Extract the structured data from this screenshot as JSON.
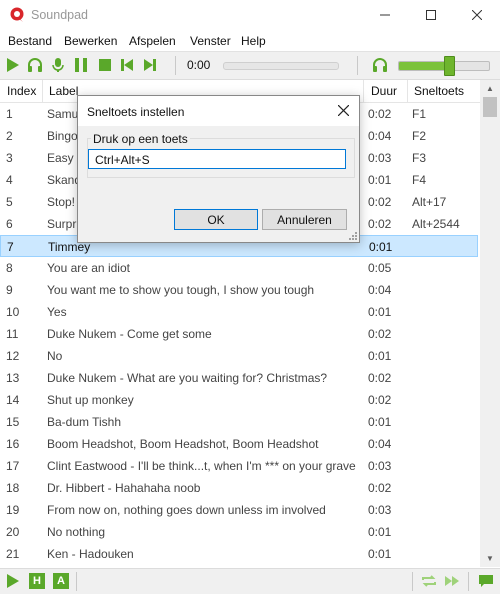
{
  "app": {
    "title": "Soundpad"
  },
  "menu": [
    "Bestand",
    "Bewerken",
    "Afspelen",
    "Venster",
    "Help"
  ],
  "player": {
    "time": "0:00",
    "progress": 0,
    "volume": 0.55
  },
  "table": {
    "columns": {
      "index": "Index",
      "label": "Label",
      "duration": "Duur",
      "hotkey": "Sneltoets"
    },
    "rows": [
      {
        "index": "1",
        "label": "Samu",
        "duration": "0:02",
        "hotkey": "F1"
      },
      {
        "index": "2",
        "label": "Bingo",
        "duration": "0:04",
        "hotkey": "F2"
      },
      {
        "index": "3",
        "label": "Easy p",
        "duration": "0:03",
        "hotkey": "F3"
      },
      {
        "index": "4",
        "label": "Skand",
        "duration": "0:01",
        "hotkey": "F4"
      },
      {
        "index": "5",
        "label": "Stop!",
        "duration": "0:02",
        "hotkey": "Alt+17"
      },
      {
        "index": "6",
        "label": "Surpr",
        "duration": "0:02",
        "hotkey": "Alt+2544"
      },
      {
        "index": "7",
        "label": "Timmey",
        "duration": "0:01",
        "hotkey": ""
      },
      {
        "index": "8",
        "label": "You are an idiot",
        "duration": "0:05",
        "hotkey": ""
      },
      {
        "index": "9",
        "label": "You want me to show you tough, I show you tough",
        "duration": "0:04",
        "hotkey": ""
      },
      {
        "index": "10",
        "label": "Yes",
        "duration": "0:01",
        "hotkey": ""
      },
      {
        "index": "11",
        "label": "Duke Nukem - Come get some",
        "duration": "0:02",
        "hotkey": ""
      },
      {
        "index": "12",
        "label": "No",
        "duration": "0:01",
        "hotkey": ""
      },
      {
        "index": "13",
        "label": "Duke Nukem - What are you waiting for? Christmas?",
        "duration": "0:02",
        "hotkey": ""
      },
      {
        "index": "14",
        "label": "Shut up monkey",
        "duration": "0:02",
        "hotkey": ""
      },
      {
        "index": "15",
        "label": "Ba-dum Tishh",
        "duration": "0:01",
        "hotkey": ""
      },
      {
        "index": "16",
        "label": "Boom Headshot, Boom Headshot, Boom Headshot",
        "duration": "0:04",
        "hotkey": ""
      },
      {
        "index": "17",
        "label": "Clint Eastwood - I'll be think...t, when I'm *** on your grave",
        "duration": "0:03",
        "hotkey": ""
      },
      {
        "index": "18",
        "label": "Dr. Hibbert - Hahahaha noob",
        "duration": "0:02",
        "hotkey": ""
      },
      {
        "index": "19",
        "label": "From now on, nothing goes down unless im involved",
        "duration": "0:03",
        "hotkey": ""
      },
      {
        "index": "20",
        "label": "No nothing",
        "duration": "0:01",
        "hotkey": ""
      },
      {
        "index": "21",
        "label": "Ken - Hadouken",
        "duration": "0:01",
        "hotkey": ""
      }
    ],
    "selected_row": 7
  },
  "status": {
    "h_label": "H",
    "a_label": "A"
  },
  "dialog": {
    "title": "Sneltoets instellen",
    "group_label": "Druk op een toets",
    "input_value": "Ctrl+Alt+S",
    "ok_label": "OK",
    "cancel_label": "Annuleren"
  },
  "colors": {
    "accent_green": "#5aa82a",
    "selection": "#cce8ff",
    "focus": "#0078d7",
    "logo_red": "#d9262b"
  }
}
